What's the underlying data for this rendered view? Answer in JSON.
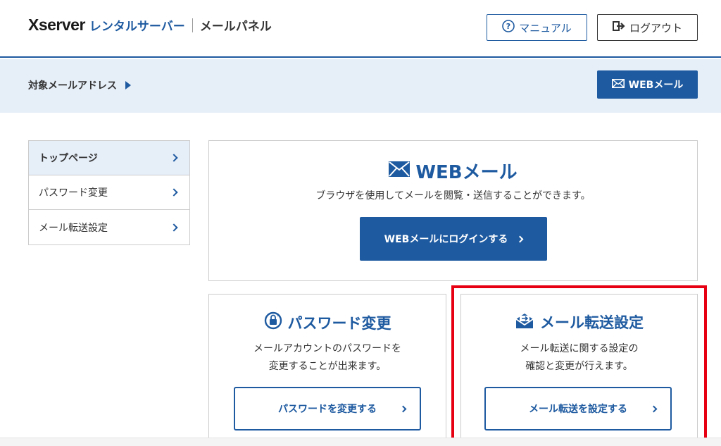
{
  "header": {
    "logo_main": "Xserver",
    "logo_sub": "レンタルサーバー",
    "panel_title": "メールパネル",
    "manual_label": "マニュアル",
    "logout_label": "ログアウト"
  },
  "address_bar": {
    "label": "対象メールアドレス",
    "webmail_button": "WEBメール"
  },
  "sidebar": {
    "items": [
      {
        "label": "トップページ",
        "active": true
      },
      {
        "label": "パスワード変更",
        "active": false
      },
      {
        "label": "メール転送設定",
        "active": false
      }
    ]
  },
  "cards": {
    "webmail": {
      "title": "WEBメール",
      "description": "ブラウザを使用してメールを閲覧・送信することができます。",
      "button": "WEBメールにログインする"
    },
    "password": {
      "title": "パスワード変更",
      "description_line1": "メールアカウントのパスワードを",
      "description_line2": "変更することが出来ます。",
      "button": "パスワードを変更する"
    },
    "forwarding": {
      "title": "メール転送設定",
      "description_line1": "メール転送に関する設定の",
      "description_line2": "確認と変更が行えます。",
      "button": "メール転送を設定する"
    }
  },
  "colors": {
    "brand": "#1e5aa0",
    "highlight": "#e60012",
    "subtle_bg": "#e6eef8"
  },
  "icons": [
    "help-icon",
    "logout-icon",
    "mail-icon",
    "lock-icon",
    "mail-forward-icon",
    "chevron-right-icon"
  ]
}
